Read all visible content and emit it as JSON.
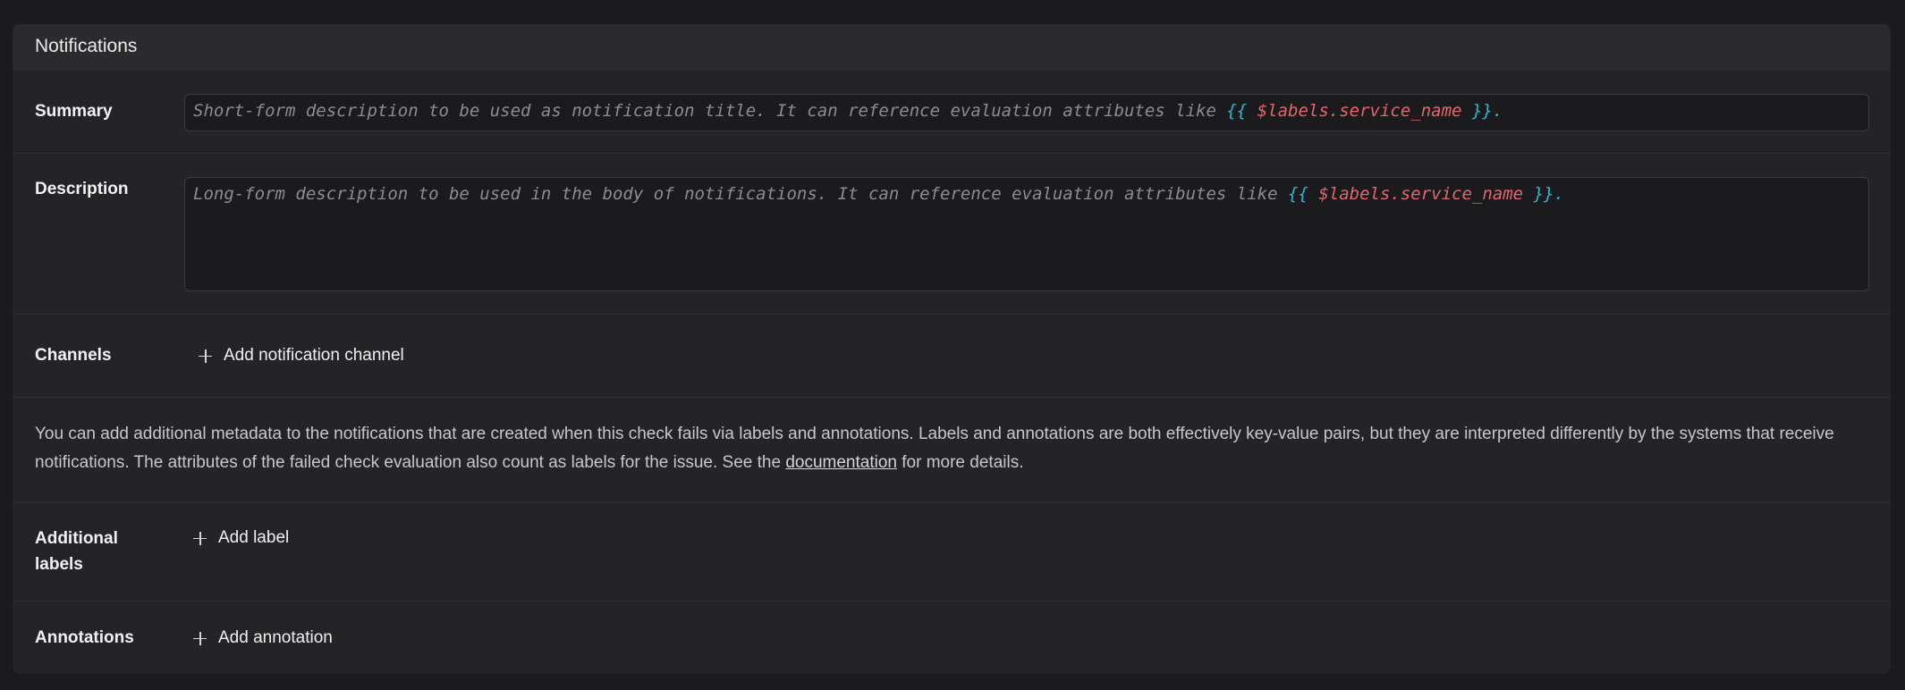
{
  "panel": {
    "title": "Notifications"
  },
  "summary": {
    "label": "Summary",
    "placeholder_prefix": "Short-form description to be used as notification title. It can reference evaluation attributes like ",
    "brace_open": "{{",
    "variable": "$labels.service_name",
    "brace_close": "}}",
    "suffix": "."
  },
  "description": {
    "label": "Description",
    "placeholder_prefix": "Long-form description to be used in the body of notifications. It can reference evaluation attributes like ",
    "brace_open": "{{",
    "variable": "$labels.service_name",
    "brace_close": "}}",
    "suffix": "."
  },
  "channels": {
    "label": "Channels",
    "add_label": "Add notification channel"
  },
  "info": {
    "text_before": "You can add additional metadata to the notifications that are created when this check fails via labels and annotations. Labels and annotations are both effectively key-value pairs, but they are interpreted differently by the systems that receive notifications. The attributes of the failed check evaluation also count as labels for the issue. See the ",
    "link": "documentation",
    "text_after": " for more details."
  },
  "labels": {
    "label": "Additional labels",
    "add_label": "Add label"
  },
  "annotations": {
    "label": "Annotations",
    "add_label": "Add annotation"
  },
  "icons": {
    "add": "plus-icon"
  },
  "colors": {
    "template_brace": "#2fb6d6",
    "template_variable": "#e6646e"
  }
}
